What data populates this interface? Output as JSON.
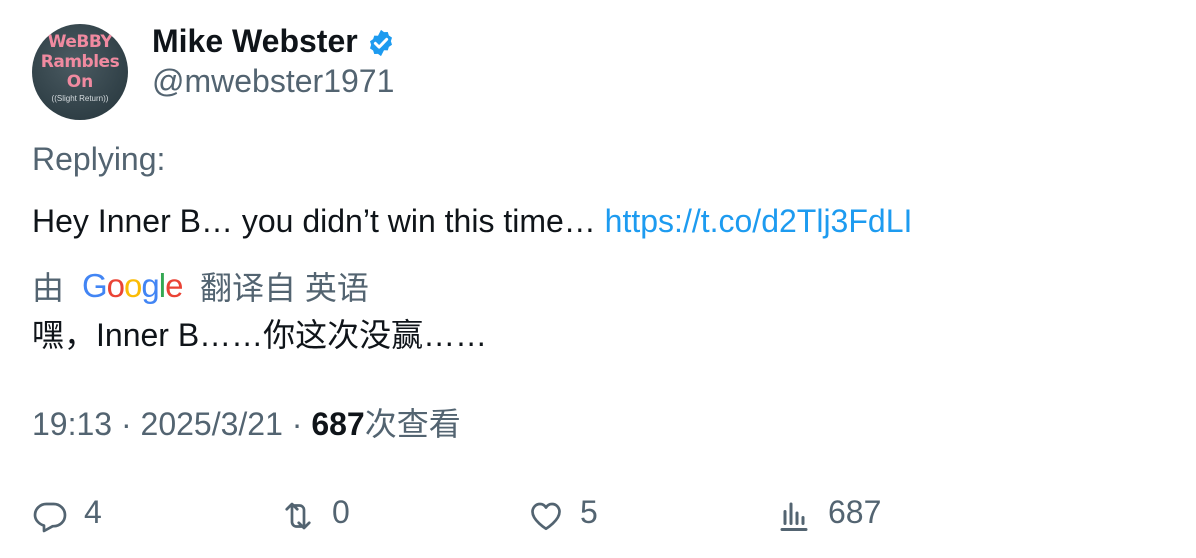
{
  "author": {
    "name": "Mike Webster",
    "handle": "@mwebster1971",
    "avatar_text": [
      "WeBBY",
      "Rambles",
      "On",
      "((Slight Return))"
    ],
    "verified_color": "#1d9bf0"
  },
  "tweet": {
    "replying_label": "Replying:",
    "text": "Hey Inner B… you didn’t win this time…",
    "link": "https://t.co/d2Tlj3FdLI"
  },
  "translation": {
    "by_label": "由",
    "provider": "Google",
    "from_label": "翻译自 英语",
    "text": "嘿，Inner B……你这次没赢……"
  },
  "meta": {
    "time": "19:13",
    "date": "2025/3/21",
    "separator": "·",
    "views_count": "687",
    "views_label": "次查看"
  },
  "actions": {
    "reply_count": "4",
    "retweet_count": "0",
    "like_count": "5",
    "views_count": "687"
  },
  "colors": {
    "text_primary": "#0f1419",
    "text_secondary": "#536471",
    "link": "#1d9bf0"
  }
}
